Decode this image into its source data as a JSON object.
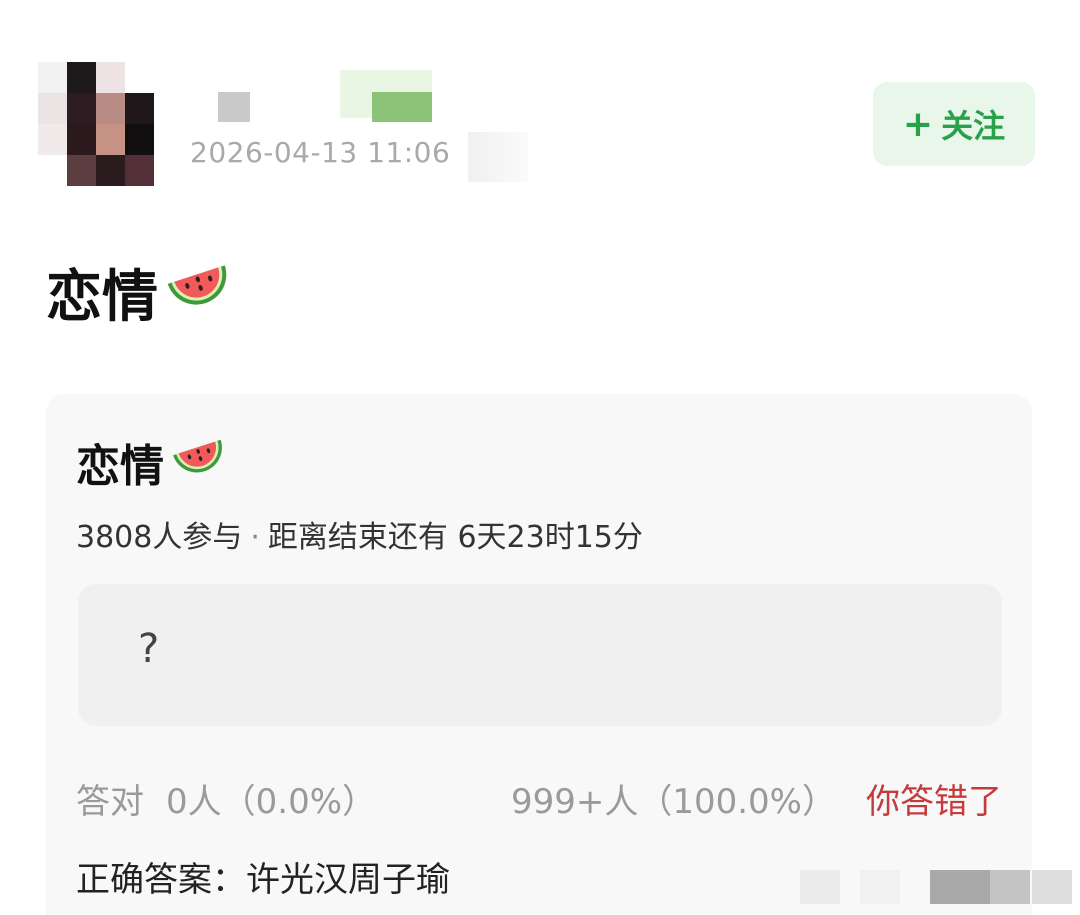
{
  "header": {
    "timestamp": "2026-04-13 11:06",
    "follow_label": "关注",
    "follow_plus": "+"
  },
  "post": {
    "title": "恋情",
    "title_icon": "watermelon-icon"
  },
  "poll": {
    "title": "恋情",
    "title_icon": "watermelon-icon",
    "participants": "3808人参与",
    "separator": "·",
    "time_left": "距离结束还有 6天23时15分",
    "option_text": "?",
    "correct_label": "答对",
    "correct_stat": "0人（0.0%）",
    "wrong_stat": "999+人（100.0%）",
    "wrong_label": "你答错了",
    "answer_label": "正确答案：",
    "answer_value": "许光汉周子瑜"
  },
  "colors": {
    "accent_green": "#27a24a",
    "follow_bg": "#e9f6ea",
    "wrong_red": "#c53b3b",
    "card_bg": "#f8f8f8",
    "option_bg": "#f0f0f0"
  }
}
